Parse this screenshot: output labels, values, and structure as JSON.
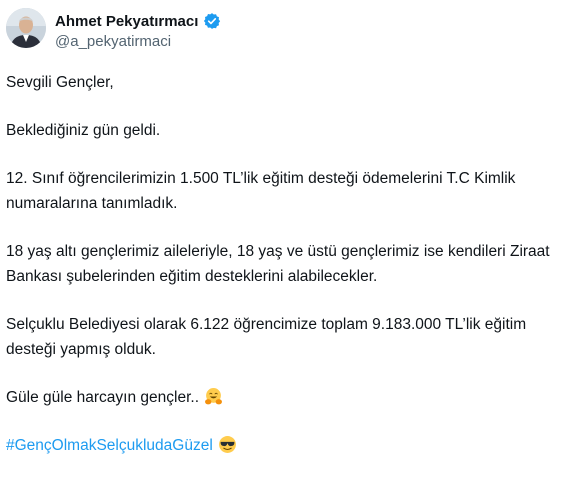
{
  "author": {
    "display_name": "Ahmet Pekyatırmacı",
    "handle": "@a_pekyatirmaci",
    "verified": true,
    "avatar_icon": "profile-photo",
    "verified_icon": "verified-badge-icon",
    "verified_color": "#1d9bf0"
  },
  "tweet": {
    "greeting": "Sevgili Gençler,",
    "line_2": "Beklediğiniz gün geldi.",
    "line_3": "12. Sınıf öğrencilerimizin 1.500 TL’lik eğitim desteği ödemelerini T.C Kimlik numaralarına tanımladık.",
    "line_4": "18 yaş altı gençlerimiz aileleriyle, 18 yaş ve üstü gençlerimiz ise kendileri Ziraat Bankası şubelerinden eğitim desteklerini alabilecekler.",
    "line_5": "Selçuklu Belediyesi olarak 6.122 öğrencimize toplam 9.183.000 TL’lik eğitim desteği yapmış olduk.",
    "line_6": "Güle güle harcayın gençler..",
    "line_6_emoji": "hugging-face-emoji",
    "hashtag": "#GençOlmakSelçukludaGüzel",
    "hashtag_emoji": "sunglasses-face-emoji",
    "hashtag_color": "#1d9bf0"
  }
}
